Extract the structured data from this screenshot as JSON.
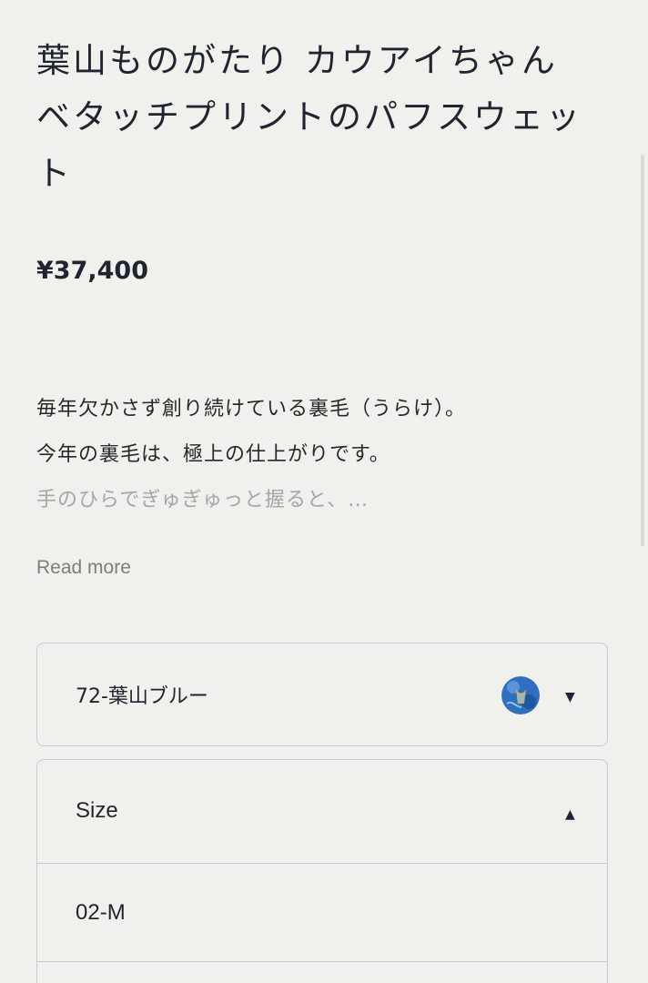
{
  "product": {
    "title": "葉山ものがたり カウアイちゃんベタッチプリントのパフスウェット",
    "price": "¥37,400"
  },
  "description": {
    "lines": [
      "毎年欠かさず創り続けている裏毛（うらけ）。",
      "今年の裏毛は、極上の仕上がりです。",
      "手のひらでぎゅぎゅっと握ると、…"
    ],
    "read_more_label": "Read more"
  },
  "color_select": {
    "selected": "72-葉山ブルー",
    "swatch_icon": "fabric-swatch-thumbnail",
    "caret": "▼",
    "state": "collapsed"
  },
  "size_select": {
    "label": "Size",
    "caret": "▲",
    "state": "expanded",
    "options": [
      "02-M"
    ]
  },
  "colors": {
    "background": "#f0f0ed",
    "text": "#1f2530",
    "muted": "#7b7e82",
    "faded": "#a4a6a8",
    "border": "#c9cacc",
    "swatch_blue": "#2f6fc0"
  }
}
